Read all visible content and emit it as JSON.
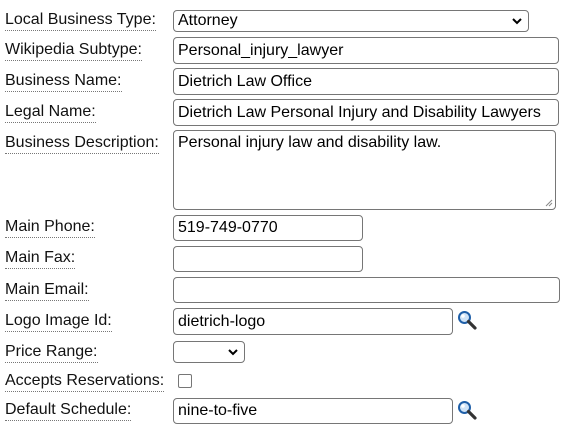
{
  "form": {
    "local_business_type": {
      "label": "Local Business Type:",
      "selected": "Attorney"
    },
    "wikipedia_subtype": {
      "label": "Wikipedia Subtype:",
      "value": "Personal_injury_lawyer"
    },
    "business_name": {
      "label": "Business Name:",
      "value": "Dietrich Law Office"
    },
    "legal_name": {
      "label": "Legal Name:",
      "value": "Dietrich Law Personal Injury and Disability Lawyers"
    },
    "business_description": {
      "label": "Business Description:",
      "value": "Personal injury law and disability law."
    },
    "main_phone": {
      "label": "Main Phone:",
      "value": "519-749-0770"
    },
    "main_fax": {
      "label": "Main Fax:",
      "value": ""
    },
    "main_email": {
      "label": "Main Email:",
      "value": ""
    },
    "logo_image_id": {
      "label": "Logo Image Id:",
      "value": "dietrich-logo",
      "lookup_icon": "magnifier-icon"
    },
    "price_range": {
      "label": "Price Range:",
      "selected": ""
    },
    "accepts_reservations": {
      "label": "Accepts Reservations:",
      "checked": false
    },
    "default_schedule": {
      "label": "Default Schedule:",
      "value": "nine-to-five",
      "lookup_icon": "magnifier-icon"
    }
  },
  "colors": {
    "border": "#767676",
    "label_underline": "#777777",
    "magnifier_lens": "#1f5fa8"
  }
}
